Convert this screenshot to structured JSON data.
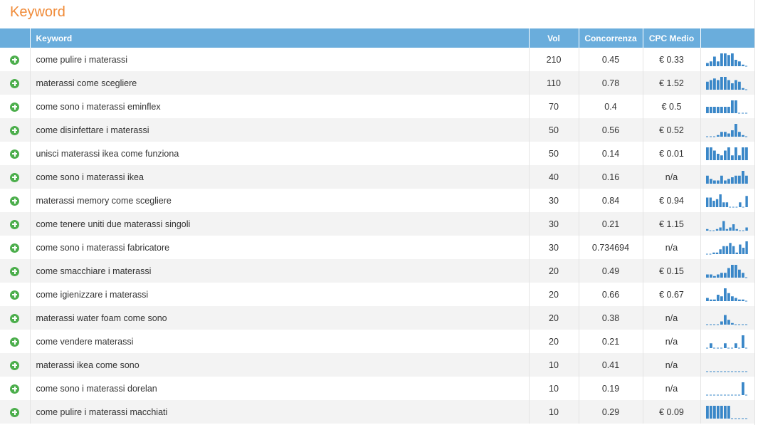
{
  "panel": {
    "title": "Keyword"
  },
  "table": {
    "headers": {
      "keyword": "Keyword",
      "vol": "Vol",
      "competition": "Concorrenza",
      "cpc": "CPC Medio",
      "trend": ""
    },
    "accent_color": "#f08a37",
    "header_color": "#6aaddc",
    "bar_color": "#3a87c8",
    "rows": [
      {
        "keyword": "come pulire i materassi",
        "vol": "210",
        "competition": "0.45",
        "cpc": "€ 0.33",
        "trend": [
          2,
          3,
          6,
          3,
          8,
          8,
          7,
          8,
          4,
          3,
          1,
          0
        ]
      },
      {
        "keyword": "materassi come scegliere",
        "vol": "110",
        "competition": "0.78",
        "cpc": "€ 1.52",
        "trend": [
          5,
          6,
          7,
          6,
          8,
          8,
          6,
          4,
          6,
          5,
          1,
          0
        ]
      },
      {
        "keyword": "come sono i materassi eminflex",
        "vol": "70",
        "competition": "0.4",
        "cpc": "€ 0.5",
        "trend": [
          4,
          4,
          4,
          4,
          4,
          4,
          4,
          8,
          8,
          0,
          0,
          0
        ]
      },
      {
        "keyword": "come disinfettare i materassi",
        "vol": "50",
        "competition": "0.56",
        "cpc": "€ 0.52",
        "trend": [
          0,
          0,
          0,
          1,
          3,
          3,
          2,
          4,
          8,
          3,
          1,
          0
        ]
      },
      {
        "keyword": "unisci materassi ikea come funziona",
        "vol": "50",
        "competition": "0.14",
        "cpc": "€ 0.01",
        "trend": [
          8,
          8,
          6,
          4,
          3,
          6,
          8,
          3,
          8,
          3,
          8,
          8
        ]
      },
      {
        "keyword": "come sono i materassi ikea",
        "vol": "40",
        "competition": "0.16",
        "cpc": "n/a",
        "trend": [
          5,
          3,
          2,
          2,
          5,
          2,
          3,
          4,
          5,
          5,
          8,
          5
        ]
      },
      {
        "keyword": "materassi memory come scegliere",
        "vol": "30",
        "competition": "0.84",
        "cpc": "€ 0.94",
        "trend": [
          6,
          6,
          4,
          5,
          8,
          3,
          3,
          0,
          0,
          0,
          3,
          0,
          7
        ]
      },
      {
        "keyword": "come tenere uniti due materassi singoli",
        "vol": "30",
        "competition": "0.21",
        "cpc": "€ 1.15",
        "trend": [
          1,
          0,
          0,
          1,
          2,
          6,
          1,
          2,
          4,
          1,
          0,
          0,
          2
        ]
      },
      {
        "keyword": "come sono i materassi fabricatore",
        "vol": "30",
        "competition": "0.734694",
        "cpc": "n/a",
        "trend": [
          0,
          0,
          1,
          1,
          3,
          5,
          5,
          7,
          5,
          1,
          6,
          4,
          8
        ]
      },
      {
        "keyword": "come smacchiare i materassi",
        "vol": "20",
        "competition": "0.49",
        "cpc": "€ 0.15",
        "trend": [
          2,
          2,
          1,
          2,
          3,
          3,
          6,
          8,
          8,
          5,
          3,
          0
        ]
      },
      {
        "keyword": "come igienizzare i materassi",
        "vol": "20",
        "competition": "0.66",
        "cpc": "€ 0.67",
        "trend": [
          2,
          1,
          1,
          4,
          3,
          8,
          5,
          3,
          2,
          1,
          1,
          0
        ]
      },
      {
        "keyword": "materassi water foam come sono",
        "vol": "20",
        "competition": "0.38",
        "cpc": "n/a",
        "trend": [
          0,
          0,
          0,
          0,
          2,
          6,
          3,
          1,
          0,
          0,
          0,
          0
        ]
      },
      {
        "keyword": "come vendere materassi",
        "vol": "20",
        "competition": "0.21",
        "cpc": "n/a",
        "trend": [
          0,
          3,
          0,
          0,
          0,
          3,
          0,
          0,
          3,
          0,
          8,
          0
        ]
      },
      {
        "keyword": "materassi ikea come sono",
        "vol": "10",
        "competition": "0.41",
        "cpc": "n/a",
        "trend": [
          0,
          0,
          0,
          0,
          0,
          0,
          0,
          0,
          0,
          0,
          0,
          0
        ]
      },
      {
        "keyword": "come sono i materassi dorelan",
        "vol": "10",
        "competition": "0.19",
        "cpc": "n/a",
        "trend": [
          0,
          0,
          0,
          0,
          0,
          0,
          0,
          0,
          0,
          0,
          8,
          0
        ]
      },
      {
        "keyword": "come pulire i materassi macchiati",
        "vol": "10",
        "competition": "0.29",
        "cpc": "€ 0.09",
        "trend": [
          8,
          8,
          8,
          8,
          8,
          8,
          8,
          0,
          0,
          0,
          0,
          0
        ]
      }
    ]
  }
}
